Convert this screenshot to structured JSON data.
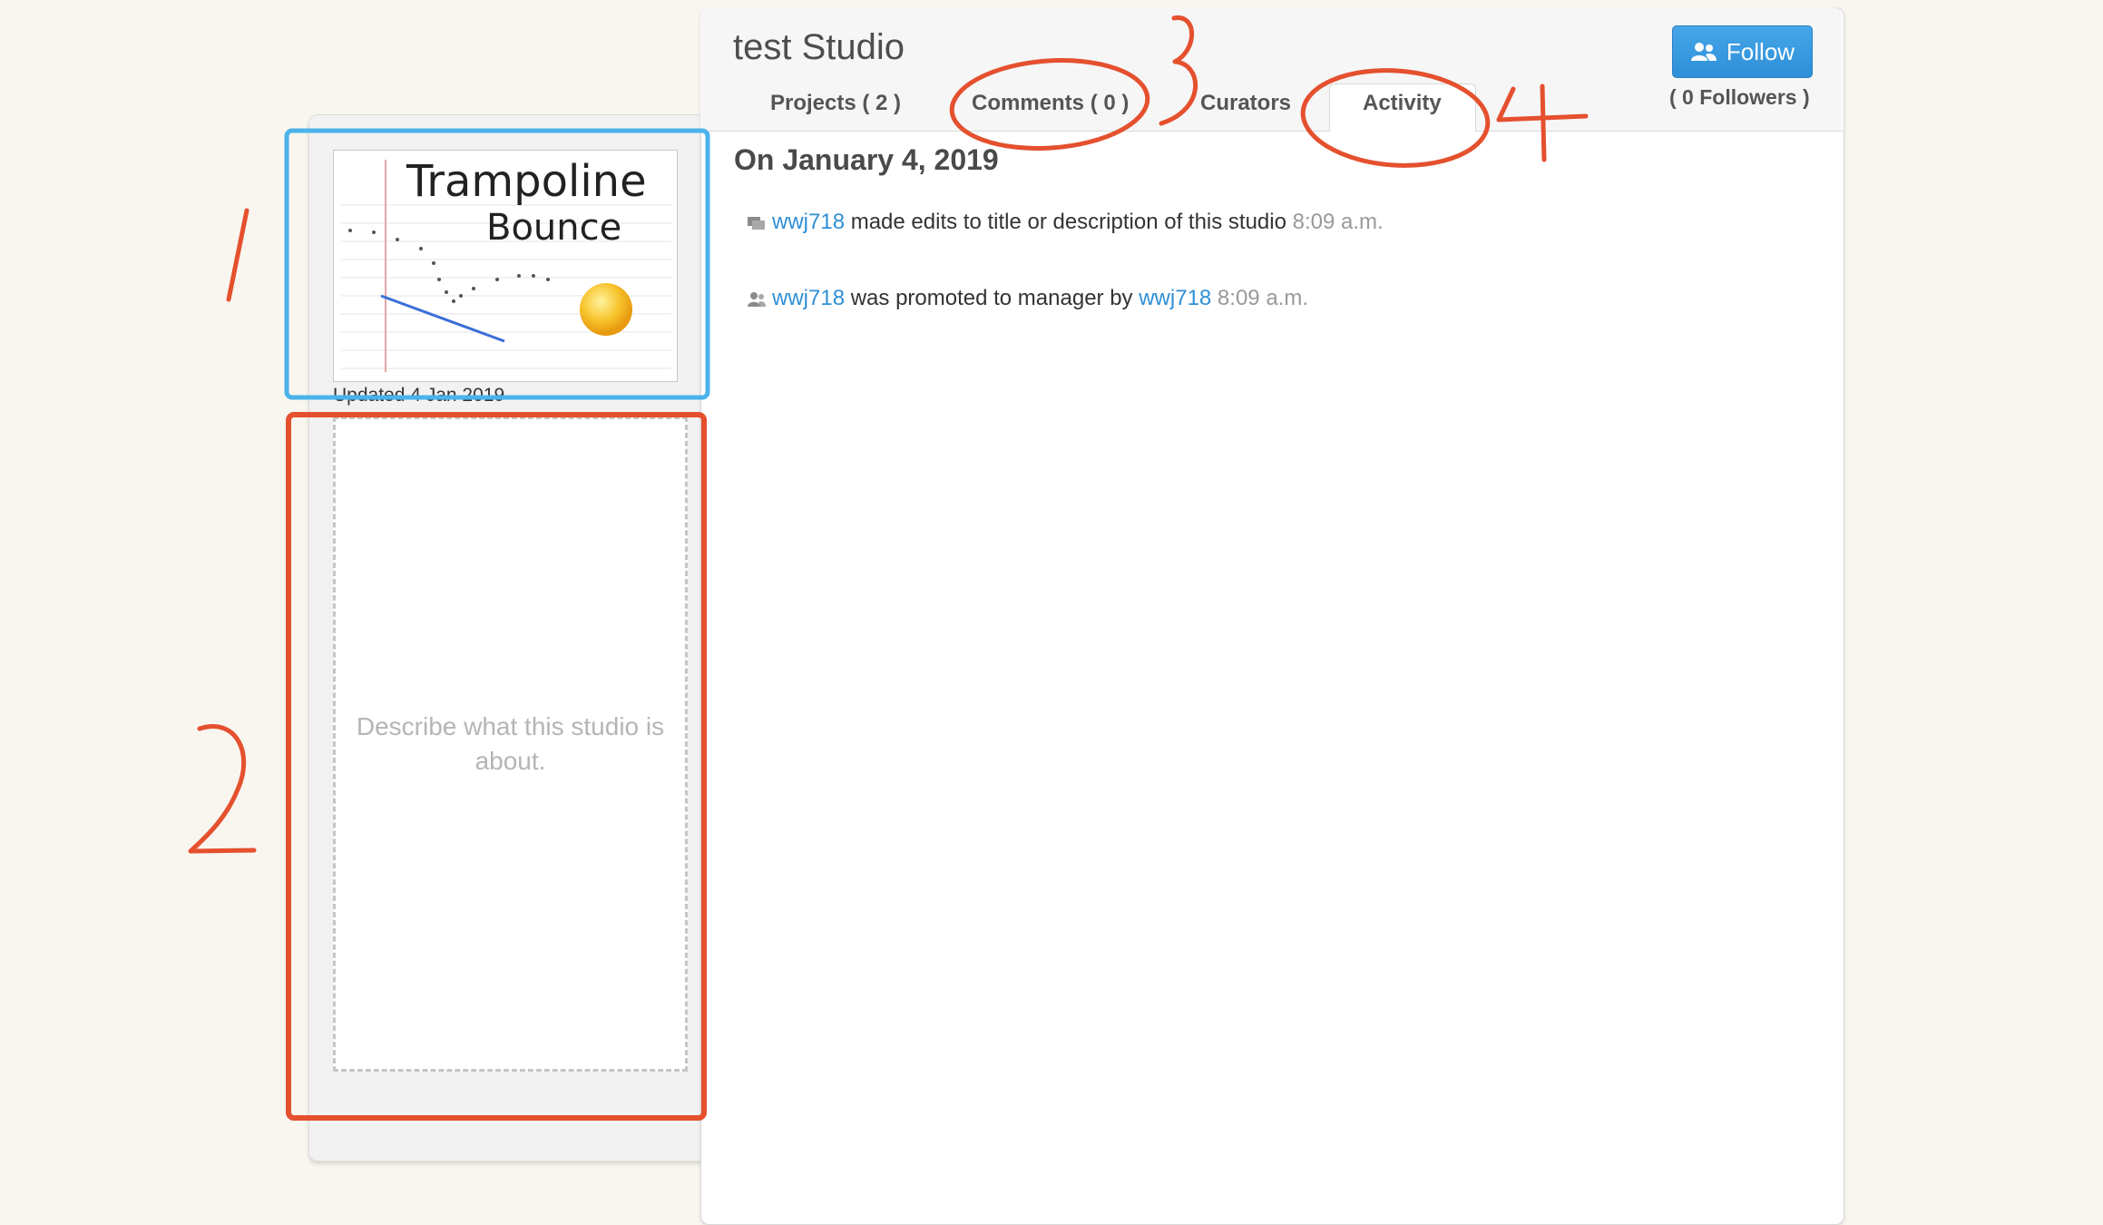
{
  "studio": {
    "title": "test Studio",
    "follow_label": "Follow",
    "followers": "( 0 Followers )"
  },
  "tabs": [
    {
      "label": "Projects ( 2 )"
    },
    {
      "label": "Comments ( 0 )"
    },
    {
      "label": "Curators"
    },
    {
      "label": "Activity",
      "active": true
    }
  ],
  "sidebar": {
    "thumbnail_text_line1": "Trampoline",
    "thumbnail_text_line2": "Bounce",
    "updated": "Updated 4 Jan 2019",
    "description_placeholder": "Describe what this studio is about."
  },
  "activity": {
    "date_heading": "On January 4, 2019",
    "items": [
      {
        "user": "wwj718",
        "text": " made edits to title or description of this studio ",
        "time": "8:09 a.m.",
        "icon": "studio-edit-icon"
      },
      {
        "user": "wwj718",
        "text": " was promoted to manager by ",
        "user2": "wwj718",
        "time": " 8:09 a.m.",
        "icon": "users-icon"
      }
    ]
  },
  "annotations": {
    "label1": "1",
    "label2": "2",
    "label3": "3",
    "label4": "4",
    "colors": {
      "blue": "#4ab3ea",
      "red": "#e5502e"
    }
  }
}
